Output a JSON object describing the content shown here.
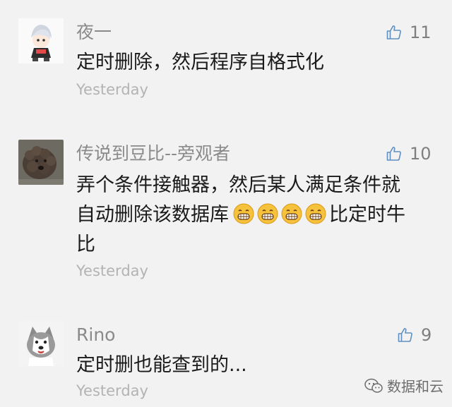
{
  "comments": [
    {
      "name": "夜一",
      "text": "定时删除，然后程序自格式化",
      "time": "Yesterday",
      "likes": "11",
      "avatar_icon": "anime-character-avatar"
    },
    {
      "name": "传说到豆比--旁观者",
      "text_line1": "弄个条件接触器，然后某人满足条件就",
      "text_line2a": "自动删除该数据库",
      "text_line2b": "比定时牛",
      "text_line3": "比",
      "emoji_count": 4,
      "emoji_icon": "grinning-face-emoji",
      "time": "Yesterday",
      "likes": "10",
      "avatar_icon": "curly-dog-avatar"
    },
    {
      "name": "Rino",
      "text": "定时删也能查到的...",
      "time": "Yesterday",
      "likes": "9",
      "avatar_icon": "husky-dog-avatar"
    }
  ],
  "watermark": {
    "label": "数据和云",
    "icon": "wechat-logo-icon"
  },
  "colors": {
    "background": "#f2f2f2",
    "name": "#8a8a8a",
    "text": "#1a1a1a",
    "time": "#b3b3b3",
    "like": "#7f7f7f"
  }
}
